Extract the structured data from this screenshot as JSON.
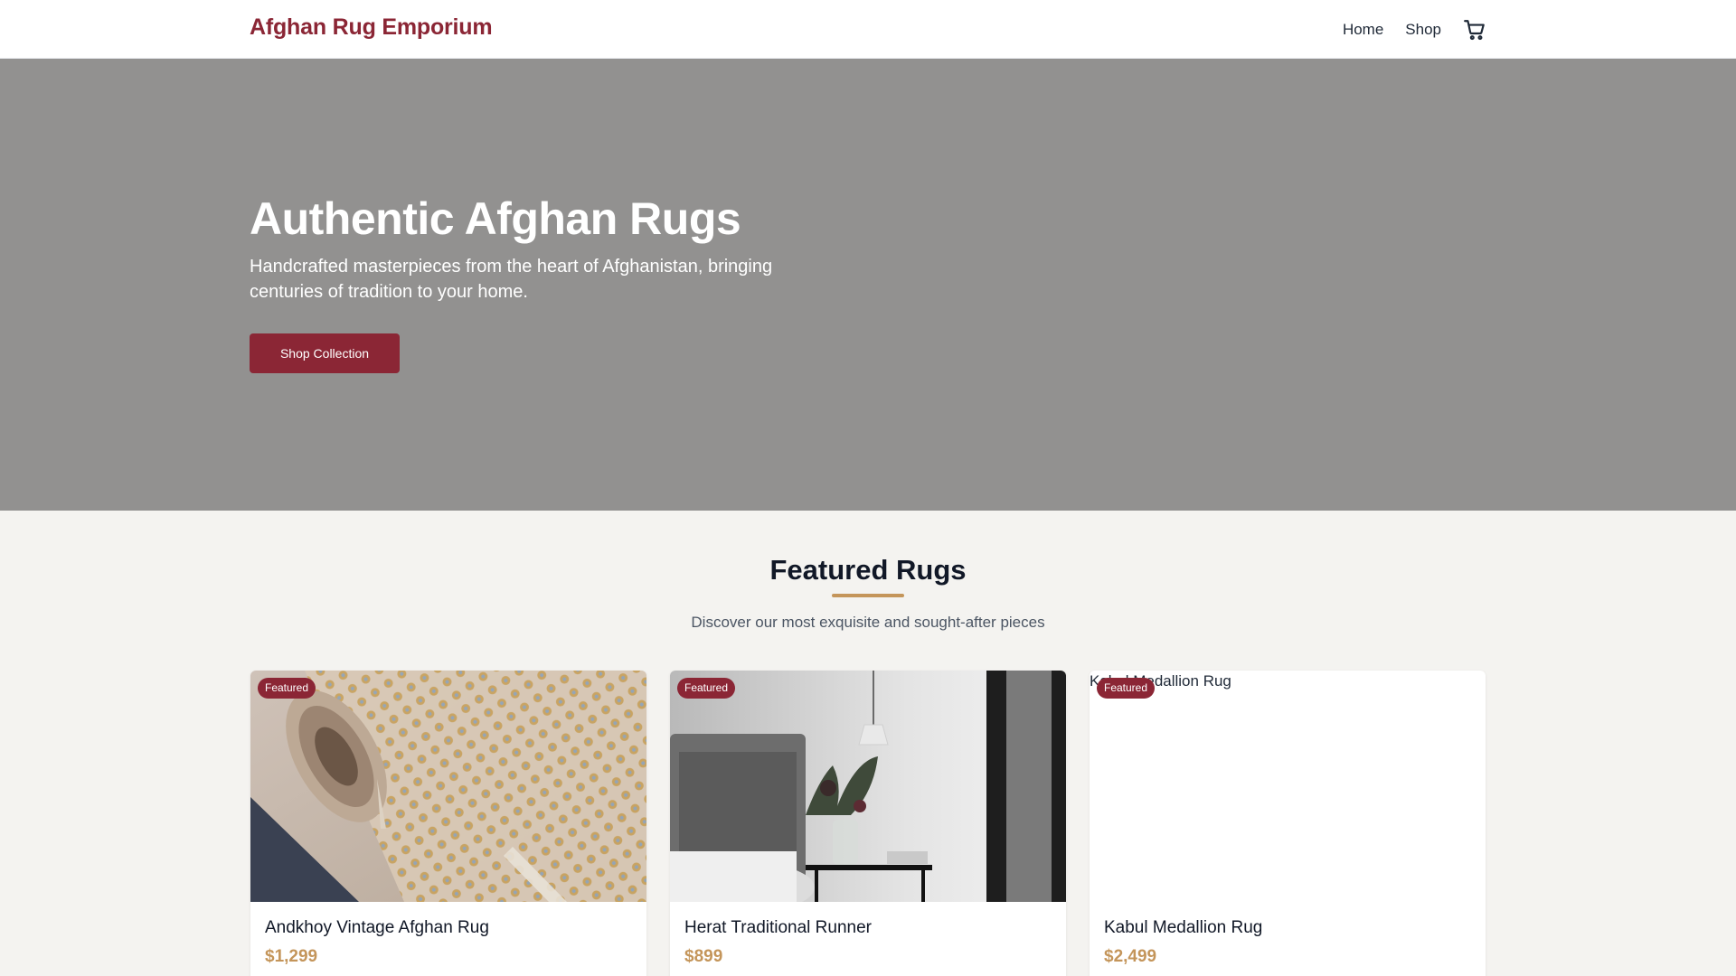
{
  "header": {
    "logo": "Afghan Rug Emporium",
    "nav": [
      {
        "label": "Home"
      },
      {
        "label": "Shop"
      }
    ],
    "cart_icon": "cart-icon"
  },
  "hero": {
    "title": "Authentic Afghan Rugs",
    "subtitle": "Handcrafted masterpieces from the heart of Afghanistan, bringing centuries of tradition to your home.",
    "button_label": "Shop Collection"
  },
  "featured": {
    "title": "Featured Rugs",
    "subtitle": "Discover our most exquisite and sought-after pieces",
    "products": [
      {
        "name": "Andkhoy Vintage Afghan Rug",
        "price": "$1,299",
        "badge": "Featured"
      },
      {
        "name": "Herat Traditional Runner",
        "price": "$899",
        "badge": "Featured"
      },
      {
        "name": "Kabul Medallion Rug",
        "price": "$2,499",
        "badge": "Featured",
        "image_alt": "Kabul Medallion Rug"
      }
    ]
  },
  "colors": {
    "brand": "#8b2635",
    "accent": "#c4955a",
    "hero_bg": "#929190",
    "page_bg": "#f4f3f0"
  }
}
